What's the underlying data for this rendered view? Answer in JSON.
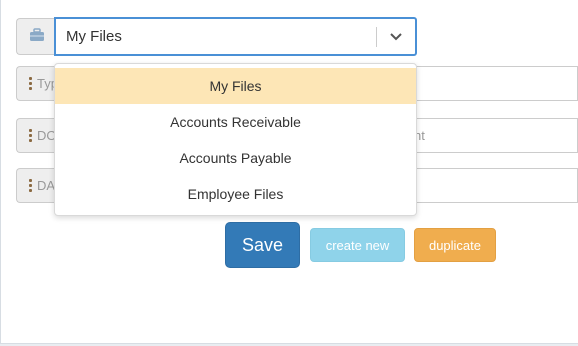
{
  "folder_select": {
    "value": "My Files",
    "icon": "briefcase-icon",
    "options": [
      {
        "label": "My Files",
        "selected": true
      },
      {
        "label": "Accounts Receivable",
        "selected": false
      },
      {
        "label": "Accounts Payable",
        "selected": false
      },
      {
        "label": "Employee Files",
        "selected": false
      }
    ]
  },
  "fields": {
    "type_label": "Typ",
    "doc_label": "DO",
    "doc_placeholder_tail": "nt",
    "date_label": "DA"
  },
  "actions": {
    "save_label": "Save",
    "create_new_label": "create new",
    "duplicate_label": "duplicate"
  },
  "colors": {
    "accent": "#337ab7",
    "focus_border": "#4a90d6",
    "selected_option": "#fde6b6",
    "create_new": "#8fd3ea",
    "duplicate": "#f0ad4e"
  }
}
